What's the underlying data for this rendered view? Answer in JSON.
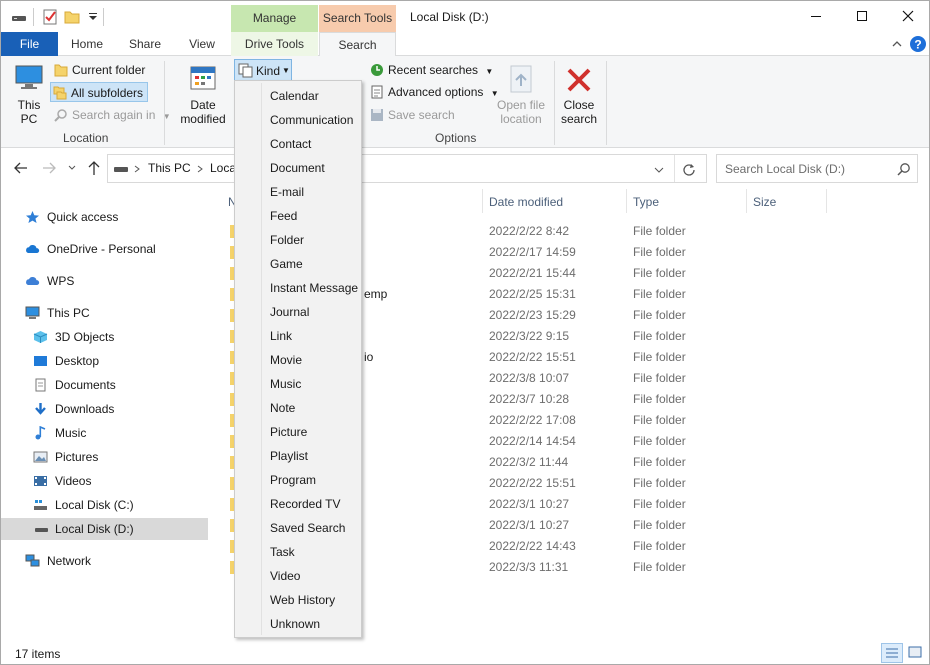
{
  "window": {
    "title": "Local Disk (D:)",
    "context_manage": "Manage",
    "context_search": "Search Tools"
  },
  "tabs": {
    "file": "File",
    "home": "Home",
    "share": "Share",
    "view": "View",
    "drive_tools": "Drive Tools",
    "search": "Search"
  },
  "ribbon": {
    "this_pc": [
      "This",
      "PC"
    ],
    "current_folder": "Current folder",
    "all_subfolders": "All subfolders",
    "search_again_in": "Search again in",
    "location_label": "Location",
    "date_modified": [
      "Date",
      "modified"
    ],
    "kind": "Kind",
    "recent_searches": "Recent searches",
    "advanced_options": "Advanced options",
    "save_search": "Save search",
    "open_file_location": [
      "Open file",
      "location"
    ],
    "close_search": [
      "Close",
      "search"
    ],
    "options_label": "Options"
  },
  "address": {
    "this_pc": "This PC",
    "current": "Local",
    "search_placeholder": "Search Local Disk (D:)"
  },
  "nav": {
    "quick_access": "Quick access",
    "onedrive": "OneDrive - Personal",
    "wps": "WPS",
    "this_pc": "This PC",
    "objects_3d": "3D Objects",
    "desktop": "Desktop",
    "documents": "Documents",
    "downloads": "Downloads",
    "music": "Music",
    "pictures": "Pictures",
    "videos": "Videos",
    "disk_c": "Local Disk (C:)",
    "disk_d": "Local Disk (D:)",
    "network": "Network"
  },
  "columns": {
    "name": "N",
    "date_modified": "Date modified",
    "type": "Type",
    "size": "Size"
  },
  "rows": [
    {
      "name": "",
      "date": "2022/2/22 8:42",
      "type": "File folder"
    },
    {
      "name": "",
      "date": "2022/2/17 14:59",
      "type": "File folder"
    },
    {
      "name": "",
      "date": "2022/2/21 15:44",
      "type": "File folder"
    },
    {
      "name": "emp",
      "date": "2022/2/25 15:31",
      "type": "File folder"
    },
    {
      "name": "",
      "date": "2022/2/23 15:29",
      "type": "File folder"
    },
    {
      "name": "",
      "date": "2022/3/22 9:15",
      "type": "File folder"
    },
    {
      "name": "io",
      "date": "2022/2/22 15:51",
      "type": "File folder"
    },
    {
      "name": "",
      "date": "2022/3/8 10:07",
      "type": "File folder"
    },
    {
      "name": "",
      "date": "2022/3/7 10:28",
      "type": "File folder"
    },
    {
      "name": "",
      "date": "2022/2/22 17:08",
      "type": "File folder"
    },
    {
      "name": "",
      "date": "2022/2/14 14:54",
      "type": "File folder"
    },
    {
      "name": "",
      "date": "2022/3/2 11:44",
      "type": "File folder"
    },
    {
      "name": "",
      "date": "2022/2/22 15:51",
      "type": "File folder"
    },
    {
      "name": "",
      "date": "2022/3/1 10:27",
      "type": "File folder"
    },
    {
      "name": "",
      "date": "2022/3/1 10:27",
      "type": "File folder"
    },
    {
      "name": "",
      "date": "2022/2/22 14:43",
      "type": "File folder"
    },
    {
      "name": "",
      "date": "2022/3/3 11:31",
      "type": "File folder"
    }
  ],
  "kind_menu": [
    "Calendar",
    "Communication",
    "Contact",
    "Document",
    "E-mail",
    "Feed",
    "Folder",
    "Game",
    "Instant Message",
    "Journal",
    "Link",
    "Movie",
    "Music",
    "Note",
    "Picture",
    "Playlist",
    "Program",
    "Recorded TV",
    "Saved Search",
    "Task",
    "Video",
    "Web History",
    "Unknown"
  ],
  "status": {
    "items": "17 items"
  },
  "colors": {
    "file_tab": "#1960b7",
    "manage_ctx": "#c7e7b0",
    "search_ctx": "#f7cbad",
    "selected_nav": "#d9d9d9",
    "close_red": "#d0312d",
    "help_blue": "#1e6fd9"
  }
}
